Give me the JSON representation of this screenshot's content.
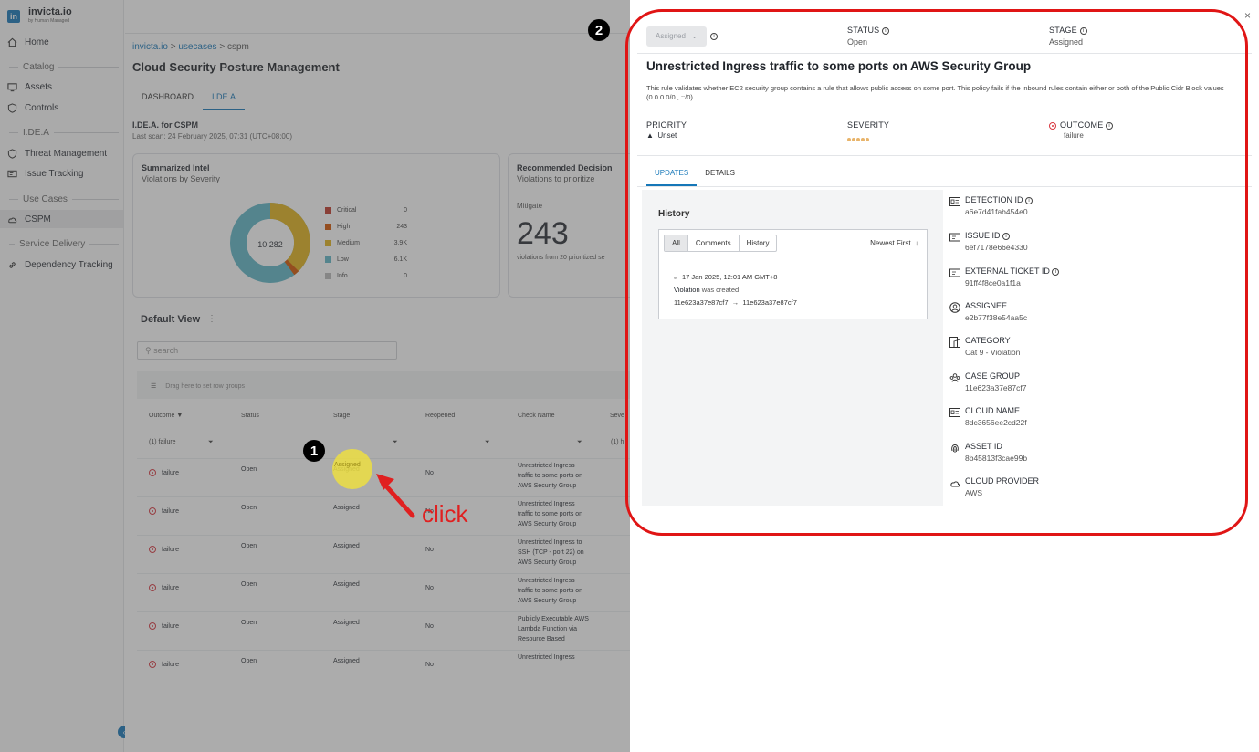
{
  "sidebar": {
    "logo_mark": "in",
    "logo_title": "invicta.io",
    "logo_sub": "by Human Managed",
    "items": [
      {
        "label": "Home",
        "icon": "home-icon"
      },
      {
        "section": "Catalog"
      },
      {
        "label": "Assets",
        "icon": "monitor-icon"
      },
      {
        "label": "Controls",
        "icon": "shield-icon"
      },
      {
        "section": "I.DE.A"
      },
      {
        "label": "Threat Management",
        "icon": "shield-icon"
      },
      {
        "label": "Issue Tracking",
        "icon": "ticket-icon"
      },
      {
        "section": "Use Cases"
      },
      {
        "label": "CSPM",
        "icon": "cloud-icon"
      },
      {
        "section": "Service Delivery"
      },
      {
        "label": "Dependency Tracking",
        "icon": "link-icon"
      }
    ],
    "collapse_glyph": "‹"
  },
  "main": {
    "breadcrumb": [
      "invicta.io",
      "usecases",
      "cspm"
    ],
    "breadcrumb_sep": ">",
    "page_title": "Cloud Security Posture Management",
    "tabs": [
      "DASHBOARD",
      "I.DE.A"
    ],
    "idea_title": "I.DE.A. for CSPM",
    "idea_sub": "Last scan: 24 February 2025, 07:31 (UTC+08:00)",
    "intel_title": "Summarized Intel",
    "intel_sub": "Violations by Severity",
    "donut_center": "10,282",
    "legend": [
      {
        "label": "Critical",
        "value": "0",
        "color": "#c0392b"
      },
      {
        "label": "High",
        "value": "243",
        "color": "#d35400"
      },
      {
        "label": "Medium",
        "value": "3.9K",
        "color": "#e2b21d"
      },
      {
        "label": "Low",
        "value": "6.1K",
        "color": "#5fb6c6"
      },
      {
        "label": "Info",
        "value": "0",
        "color": "#bbbbbb"
      }
    ],
    "rec_title": "Recommended Decision",
    "rec_sub": "Violations to prioritize",
    "rec_action": "Mitigate",
    "rec_number": "243",
    "rec_caption": "violations from 20 prioritized se",
    "view_title": "Default View",
    "view_menu": "⋮",
    "search_placeholder": "search",
    "group_hint": "Drag here to set row groups",
    "columns": [
      "Outcome",
      "Status",
      "Stage",
      "Reopened",
      "Check Name",
      "Seve"
    ],
    "filters": {
      "outcome": "(1) failure",
      "severity": "(1) h"
    },
    "rows": [
      {
        "outcome": "failure",
        "status": "Open",
        "stage": "Assigned",
        "reopened": "No",
        "check": "Unrestricted Ingress traffic to some ports on AWS Security Group"
      },
      {
        "outcome": "failure",
        "status": "Open",
        "stage": "Assigned",
        "reopened": "No",
        "check": "Unrestricted Ingress traffic to some ports on AWS Security Group"
      },
      {
        "outcome": "failure",
        "status": "Open",
        "stage": "Assigned",
        "reopened": "No",
        "check": "Unrestricted Ingress to SSH (TCP - port 22) on AWS Security Group"
      },
      {
        "outcome": "failure",
        "status": "Open",
        "stage": "Assigned",
        "reopened": "No",
        "check": "Unrestricted Ingress traffic to some ports on AWS Security Group"
      },
      {
        "outcome": "failure",
        "status": "Open",
        "stage": "Assigned",
        "reopened": "No",
        "check": "Publicly Executable AWS Lambda Function via Resource Based"
      },
      {
        "outcome": "failure",
        "status": "Open",
        "stage": "Assigned",
        "reopened": "No",
        "check": "Unrestricted Ingress"
      }
    ]
  },
  "annotation": {
    "step1": "1",
    "step2": "2",
    "click_text": "click"
  },
  "drawer": {
    "stage_select": "Assigned",
    "status_label": "STATUS",
    "status_value": "Open",
    "stage_label": "STAGE",
    "stage_value": "Assigned",
    "title": "Unrestricted Ingress traffic to some ports on AWS Security Group",
    "description": "This rule validates whether EC2 security group contains a rule that allows public access on some port. This policy fails if the inbound rules contain either or both of the Public Cidr Block values (0.0.0.0/0 , ::/0).",
    "priority_label": "PRIORITY",
    "priority_value": "Unset",
    "severity_label": "SEVERITY",
    "outcome_label": "OUTCOME",
    "outcome_value": "failure",
    "tabs": [
      "UPDATES",
      "DETAILS"
    ],
    "history": {
      "title": "History",
      "filters": [
        "All",
        "Comments",
        "History"
      ],
      "sort": "Newest First",
      "event_time": "17 Jan 2025, 12:01 AM GMT+8",
      "event_action": "Violation",
      "event_text": "was created",
      "event_from": "11e623a37e87cf7",
      "event_to": "11e623a37e87cf7"
    },
    "fields": [
      {
        "label": "DETECTION ID",
        "value": "a6e7d41fab454e0",
        "icon": "id-card-icon",
        "info": true
      },
      {
        "label": "ISSUE ID",
        "value": "6ef7178e66e4330",
        "icon": "ticket-icon",
        "info": true
      },
      {
        "label": "EXTERNAL TICKET ID",
        "value": "91ff4f8ce0a1f1a",
        "icon": "ticket-icon",
        "info": true
      },
      {
        "label": "ASSIGNEE",
        "value": "e2b77f38e54aa5c",
        "icon": "user-circle-icon",
        "info": false
      },
      {
        "label": "CATEGORY",
        "value": "Cat 9 - Violation",
        "icon": "category-icon",
        "info": false
      },
      {
        "label": "CASE GROUP",
        "value": "11e623a37e87cf7",
        "icon": "group-icon",
        "info": false
      },
      {
        "label": "CLOUD NAME",
        "value": "8dc3656ee2cd22f",
        "icon": "id-card-icon",
        "info": false
      },
      {
        "label": "ASSET ID",
        "value": "8b45813f3cae99b",
        "icon": "fingerprint-icon",
        "info": false
      },
      {
        "label": "CLOUD PROVIDER",
        "value": "AWS",
        "icon": "cloud-icon",
        "info": false
      }
    ],
    "close_glyph": "×"
  }
}
